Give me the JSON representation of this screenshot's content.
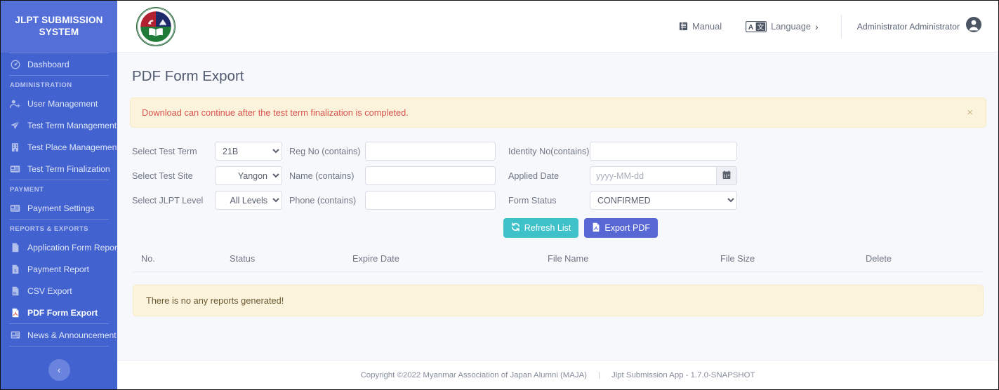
{
  "sidebar": {
    "brand": "JLPT SUBMISSION SYSTEM",
    "dashboard": {
      "label": "Dashboard",
      "icon": "dashboard-icon"
    },
    "sections": [
      {
        "title": "ADMINISTRATION",
        "items": [
          {
            "label": "User Management",
            "icon": "user-plus-icon",
            "active": false
          },
          {
            "label": "Test Term Management",
            "icon": "paper-plane-icon",
            "active": false
          },
          {
            "label": "Test Place Management",
            "icon": "building-icon",
            "active": false
          },
          {
            "label": "Test Term Finalization",
            "icon": "card-icon",
            "active": false
          }
        ]
      },
      {
        "title": "PAYMENT",
        "items": [
          {
            "label": "Payment Settings",
            "icon": "card-icon",
            "active": false
          }
        ]
      },
      {
        "title": "REPORTS & EXPORTS",
        "items": [
          {
            "label": "Application Form Report",
            "icon": "file-icon",
            "active": false
          },
          {
            "label": "Payment Report",
            "icon": "file-dollar-icon",
            "active": false
          },
          {
            "label": "CSV Export",
            "icon": "file-csv-icon",
            "active": false
          },
          {
            "label": "PDF Form Export",
            "icon": "file-pdf-icon",
            "active": true
          },
          {
            "label": "News & Announcement",
            "icon": "news-icon",
            "active": false
          }
        ]
      }
    ],
    "collapse_label": "‹"
  },
  "topbar": {
    "logo_alt": "MAJA Logo",
    "manual": "Manual",
    "language": "Language",
    "language_chevron": "›",
    "user_name": "Administrator Administrator"
  },
  "page": {
    "title": "PDF Form Export",
    "alert": {
      "text": "Download can continue after the test term finalization is completed.",
      "close": "×"
    }
  },
  "filters": {
    "test_term": {
      "label": "Select Test Term",
      "value": "21B",
      "options": [
        "21B"
      ]
    },
    "reg_no": {
      "label": "Reg No (contains)",
      "value": "",
      "placeholder": ""
    },
    "identity_no": {
      "label": "Identity No(contains)",
      "value": "",
      "placeholder": ""
    },
    "test_site": {
      "label": "Select Test Site",
      "value": "Yangon",
      "options": [
        "Yangon"
      ]
    },
    "name": {
      "label": "Name (contains)",
      "value": "",
      "placeholder": ""
    },
    "applied_date": {
      "label": "Applied Date",
      "value": "",
      "placeholder": "yyyy-MM-dd"
    },
    "jlpt_level": {
      "label": "Select JLPT Level",
      "value": "All Levels",
      "options": [
        "All Levels"
      ]
    },
    "phone": {
      "label": "Phone (contains)",
      "value": "",
      "placeholder": ""
    },
    "form_status": {
      "label": "Form Status",
      "value": "CONFIRMED",
      "options": [
        "CONFIRMED"
      ]
    },
    "refresh_button": "Refresh List",
    "export_button": "Export PDF"
  },
  "table": {
    "columns": [
      "No.",
      "Status",
      "Expire Date",
      "File Name",
      "File Size",
      "Delete"
    ],
    "rows": [],
    "empty_message": "There is no any reports generated!"
  },
  "footer": {
    "copyright": "Copyright ©2022 Myanmar Association of Japan Alumni (MAJA)",
    "separator": "|",
    "version": "Jlpt Submission App - 1.7.0-SNAPSHOT"
  },
  "colors": {
    "sidebar_bg": "#4263cf",
    "sidebar_header_bg": "#5470d8",
    "content_bg": "#f7f8fc",
    "alert_bg": "#fcf3dc",
    "alert_text": "#d9534f",
    "refresh_btn": "#3ec1c9",
    "export_btn": "#5768d5"
  }
}
